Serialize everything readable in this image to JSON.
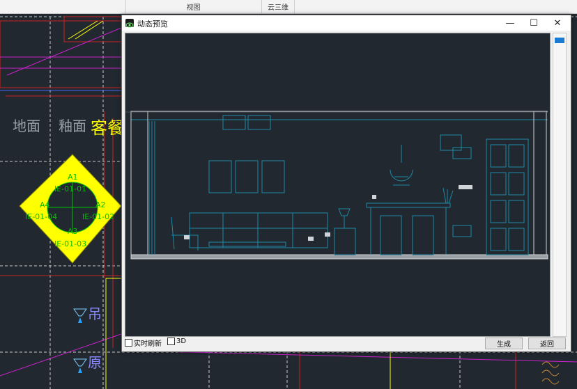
{
  "ribbon": {
    "groups": [
      {
        "label": "视图"
      },
      {
        "label": "云三维"
      }
    ]
  },
  "background_drawing": {
    "labels": {
      "floor_text": "地面",
      "glaze_text": "釉面",
      "room_text": "客餐",
      "pendant_text": "吊",
      "original_text": "原"
    },
    "marker": {
      "top_code": "A1",
      "top_ref": "IE-01-01",
      "left_code": "A4",
      "left_ref": "IE-01-04",
      "right_code": "A2",
      "right_ref": "IE-01-02",
      "bottom_code": "A3",
      "bottom_ref": "IE-01-03"
    }
  },
  "dialog": {
    "title": "动态预览",
    "window_controls": {
      "minimize": "—",
      "maximize": "☐",
      "close": "✕"
    },
    "realtime_refresh_label": "实时刷新",
    "realtime_refresh_checked": false,
    "three_d_label": "3D",
    "three_d_checked": false,
    "generate_label": "生成",
    "back_label": "返回"
  },
  "colors": {
    "cad_background": "#212830",
    "preview_lines": "#1d8aa6",
    "marker_fill": "#ffff00",
    "marker_text": "#00c000"
  }
}
